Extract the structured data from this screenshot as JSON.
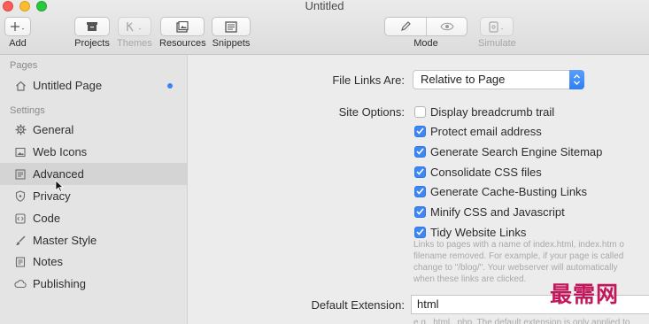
{
  "window": {
    "title": "Untitled"
  },
  "toolbar": {
    "add_label": "Add",
    "projects_label": "Projects",
    "themes_label": "Themes",
    "resources_label": "Resources",
    "snippets_label": "Snippets",
    "mode_label": "Mode",
    "simulate_label": "Simulate"
  },
  "sidebar": {
    "pages_header": "Pages",
    "pages": [
      {
        "label": "Untitled Page",
        "icon": "home-icon"
      }
    ],
    "settings_header": "Settings",
    "settings": [
      {
        "label": "General",
        "icon": "gear-icon"
      },
      {
        "label": "Web Icons",
        "icon": "image-icon"
      },
      {
        "label": "Advanced",
        "icon": "advanced-icon",
        "selected": true
      },
      {
        "label": "Privacy",
        "icon": "shield-icon"
      },
      {
        "label": "Code",
        "icon": "code-icon"
      },
      {
        "label": "Master Style",
        "icon": "brush-icon"
      },
      {
        "label": "Notes",
        "icon": "notes-icon"
      },
      {
        "label": "Publishing",
        "icon": "cloud-icon"
      }
    ]
  },
  "main": {
    "file_links_label": "File Links Are:",
    "file_links_value": "Relative to Page",
    "site_options_label": "Site Options:",
    "options": [
      {
        "label": "Display breadcrumb trail",
        "checked": false
      },
      {
        "label": "Protect email address",
        "checked": true
      },
      {
        "label": "Generate Search Engine Sitemap",
        "checked": true
      },
      {
        "label": "Consolidate CSS files",
        "checked": true
      },
      {
        "label": "Generate Cache-Busting Links",
        "checked": true
      },
      {
        "label": "Minify CSS and Javascript",
        "checked": true
      },
      {
        "label": "Tidy Website Links",
        "checked": true
      }
    ],
    "tidy_help": [
      "Links to pages with a name of index.html, index.htm o",
      "filename removed. For example, if your page is called",
      "change to \"/blog/\". Your webserver will automatically",
      "when these links are clicked."
    ],
    "default_extension_label": "Default Extension:",
    "default_extension_value": "html",
    "extension_help": "e.g. .html, .php. The default extension is only applied to"
  },
  "watermark": "最需网",
  "colors": {
    "accent": "#3d87f5",
    "selected_row": "#d4d4d4",
    "sidebar_bg": "#e4e4e4",
    "watermark": "#c2185b"
  }
}
